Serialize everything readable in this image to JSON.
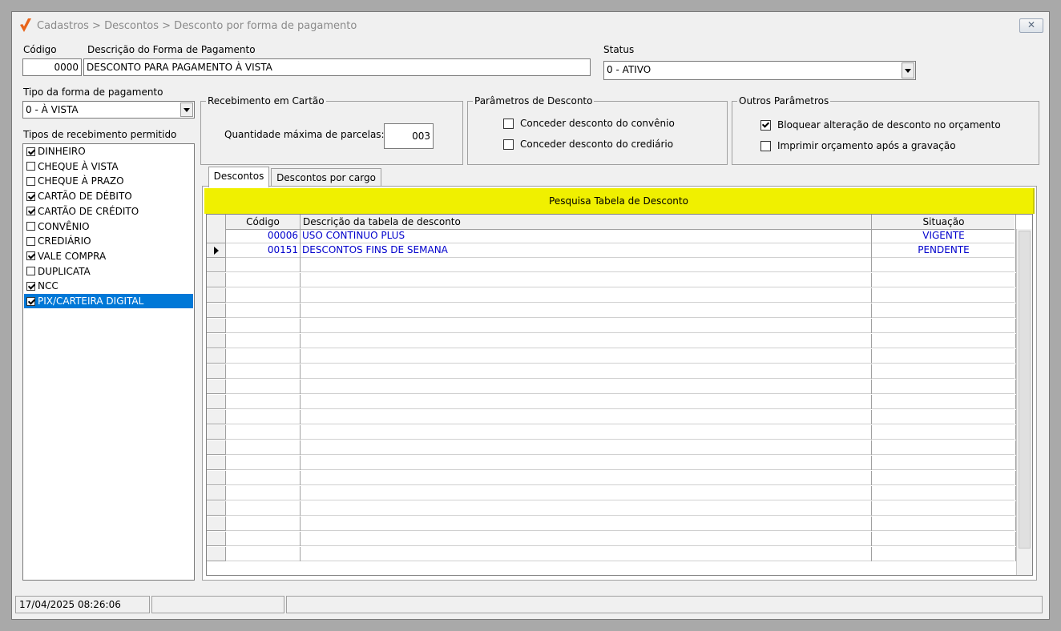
{
  "window": {
    "title": "Cadastros > Descontos > Desconto por forma de pagamento",
    "close_label": "✕",
    "brand_color": "#e8641a"
  },
  "header": {
    "codigo_label": "Código",
    "codigo_value": "0000",
    "descricao_label": "Descrição do Forma de Pagamento",
    "descricao_value": "DESCONTO PARA PAGAMENTO À VISTA",
    "status_label": "Status",
    "status_value": "0 - ATIVO"
  },
  "tipo_forma": {
    "label": "Tipo da forma de pagamento",
    "value": "0 - À VISTA"
  },
  "tipos_recebimento": {
    "label": "Tipos de recebimento permitido",
    "items": [
      {
        "label": "DINHEIRO",
        "checked": true
      },
      {
        "label": "CHEQUE À VISTA",
        "checked": false
      },
      {
        "label": "CHEQUE À PRAZO",
        "checked": false
      },
      {
        "label": "CARTÃO DE DÉBITO",
        "checked": true
      },
      {
        "label": "CARTÃO DE CRÉDITO",
        "checked": true
      },
      {
        "label": "CONVÊNIO",
        "checked": false
      },
      {
        "label": "CREDIÁRIO",
        "checked": false
      },
      {
        "label": "VALE COMPRA",
        "checked": true
      },
      {
        "label": "DUPLICATA",
        "checked": false
      },
      {
        "label": "NCC",
        "checked": true
      },
      {
        "label": "PIX/CARTEIRA DIGITAL",
        "checked": true,
        "selected": true
      }
    ]
  },
  "recebimento_cartao": {
    "title": "Recebimento em Cartão",
    "qtd_label": "Quantidade máxima de parcelas:",
    "qtd_value": "003"
  },
  "parametros_desconto": {
    "title": "Parâmetros de Desconto",
    "options": [
      {
        "label": "Conceder desconto do convênio",
        "checked": false
      },
      {
        "label": "Conceder desconto do crediário",
        "checked": false
      }
    ]
  },
  "outros_parametros": {
    "title": "Outros Parâmetros",
    "options": [
      {
        "label": "Bloquear alteração de desconto no orçamento",
        "checked": true
      },
      {
        "label": "Imprimir orçamento após a gravação",
        "checked": false
      }
    ]
  },
  "tabs": [
    {
      "label": "Descontos",
      "active": true
    },
    {
      "label": "Descontos por cargo",
      "active": false
    }
  ],
  "search_bar": {
    "label": "Pesquisa Tabela de Desconto",
    "color": "#f0f000"
  },
  "grid": {
    "columns": [
      "Código",
      "Descrição da tabela de desconto",
      "Situação"
    ],
    "rows": [
      {
        "codigo": "00006",
        "descricao": "USO CONTINUO PLUS",
        "situacao": "VIGENTE",
        "current": false
      },
      {
        "codigo": "00151",
        "descricao": "DESCONTOS FINS DE SEMANA",
        "situacao": "PENDENTE",
        "current": true
      }
    ]
  },
  "status_bar": {
    "datetime": "17/04/2025 08:26:06",
    "pane2": "",
    "pane3": ""
  }
}
